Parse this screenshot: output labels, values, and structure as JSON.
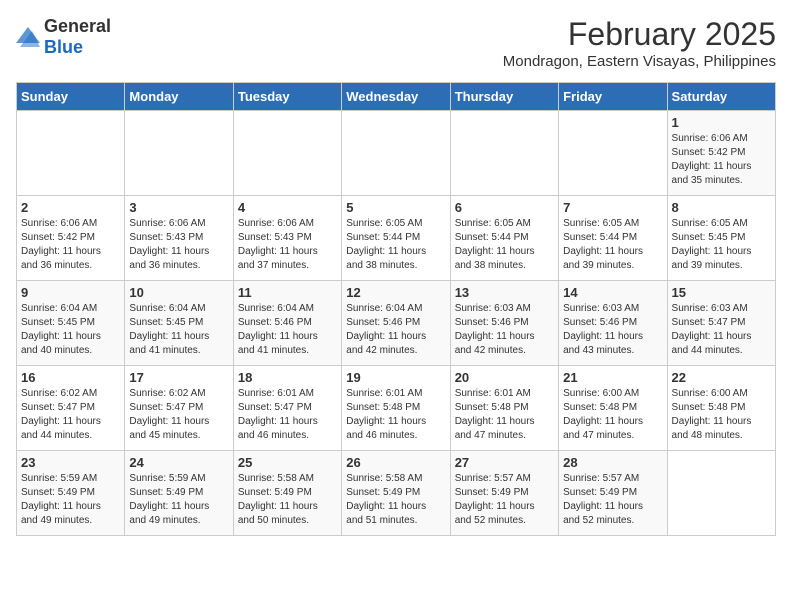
{
  "header": {
    "logo_general": "General",
    "logo_blue": "Blue",
    "main_title": "February 2025",
    "subtitle": "Mondragon, Eastern Visayas, Philippines"
  },
  "calendar": {
    "days_of_week": [
      "Sunday",
      "Monday",
      "Tuesday",
      "Wednesday",
      "Thursday",
      "Friday",
      "Saturday"
    ],
    "weeks": [
      {
        "days": [
          {
            "number": "",
            "info": ""
          },
          {
            "number": "",
            "info": ""
          },
          {
            "number": "",
            "info": ""
          },
          {
            "number": "",
            "info": ""
          },
          {
            "number": "",
            "info": ""
          },
          {
            "number": "",
            "info": ""
          },
          {
            "number": "1",
            "info": "Sunrise: 6:06 AM\nSunset: 5:42 PM\nDaylight: 11 hours\nand 35 minutes."
          }
        ]
      },
      {
        "days": [
          {
            "number": "2",
            "info": "Sunrise: 6:06 AM\nSunset: 5:42 PM\nDaylight: 11 hours\nand 36 minutes."
          },
          {
            "number": "3",
            "info": "Sunrise: 6:06 AM\nSunset: 5:43 PM\nDaylight: 11 hours\nand 36 minutes."
          },
          {
            "number": "4",
            "info": "Sunrise: 6:06 AM\nSunset: 5:43 PM\nDaylight: 11 hours\nand 37 minutes."
          },
          {
            "number": "5",
            "info": "Sunrise: 6:05 AM\nSunset: 5:44 PM\nDaylight: 11 hours\nand 38 minutes."
          },
          {
            "number": "6",
            "info": "Sunrise: 6:05 AM\nSunset: 5:44 PM\nDaylight: 11 hours\nand 38 minutes."
          },
          {
            "number": "7",
            "info": "Sunrise: 6:05 AM\nSunset: 5:44 PM\nDaylight: 11 hours\nand 39 minutes."
          },
          {
            "number": "8",
            "info": "Sunrise: 6:05 AM\nSunset: 5:45 PM\nDaylight: 11 hours\nand 39 minutes."
          }
        ]
      },
      {
        "days": [
          {
            "number": "9",
            "info": "Sunrise: 6:04 AM\nSunset: 5:45 PM\nDaylight: 11 hours\nand 40 minutes."
          },
          {
            "number": "10",
            "info": "Sunrise: 6:04 AM\nSunset: 5:45 PM\nDaylight: 11 hours\nand 41 minutes."
          },
          {
            "number": "11",
            "info": "Sunrise: 6:04 AM\nSunset: 5:46 PM\nDaylight: 11 hours\nand 41 minutes."
          },
          {
            "number": "12",
            "info": "Sunrise: 6:04 AM\nSunset: 5:46 PM\nDaylight: 11 hours\nand 42 minutes."
          },
          {
            "number": "13",
            "info": "Sunrise: 6:03 AM\nSunset: 5:46 PM\nDaylight: 11 hours\nand 42 minutes."
          },
          {
            "number": "14",
            "info": "Sunrise: 6:03 AM\nSunset: 5:46 PM\nDaylight: 11 hours\nand 43 minutes."
          },
          {
            "number": "15",
            "info": "Sunrise: 6:03 AM\nSunset: 5:47 PM\nDaylight: 11 hours\nand 44 minutes."
          }
        ]
      },
      {
        "days": [
          {
            "number": "16",
            "info": "Sunrise: 6:02 AM\nSunset: 5:47 PM\nDaylight: 11 hours\nand 44 minutes."
          },
          {
            "number": "17",
            "info": "Sunrise: 6:02 AM\nSunset: 5:47 PM\nDaylight: 11 hours\nand 45 minutes."
          },
          {
            "number": "18",
            "info": "Sunrise: 6:01 AM\nSunset: 5:47 PM\nDaylight: 11 hours\nand 46 minutes."
          },
          {
            "number": "19",
            "info": "Sunrise: 6:01 AM\nSunset: 5:48 PM\nDaylight: 11 hours\nand 46 minutes."
          },
          {
            "number": "20",
            "info": "Sunrise: 6:01 AM\nSunset: 5:48 PM\nDaylight: 11 hours\nand 47 minutes."
          },
          {
            "number": "21",
            "info": "Sunrise: 6:00 AM\nSunset: 5:48 PM\nDaylight: 11 hours\nand 47 minutes."
          },
          {
            "number": "22",
            "info": "Sunrise: 6:00 AM\nSunset: 5:48 PM\nDaylight: 11 hours\nand 48 minutes."
          }
        ]
      },
      {
        "days": [
          {
            "number": "23",
            "info": "Sunrise: 5:59 AM\nSunset: 5:49 PM\nDaylight: 11 hours\nand 49 minutes."
          },
          {
            "number": "24",
            "info": "Sunrise: 5:59 AM\nSunset: 5:49 PM\nDaylight: 11 hours\nand 49 minutes."
          },
          {
            "number": "25",
            "info": "Sunrise: 5:58 AM\nSunset: 5:49 PM\nDaylight: 11 hours\nand 50 minutes."
          },
          {
            "number": "26",
            "info": "Sunrise: 5:58 AM\nSunset: 5:49 PM\nDaylight: 11 hours\nand 51 minutes."
          },
          {
            "number": "27",
            "info": "Sunrise: 5:57 AM\nSunset: 5:49 PM\nDaylight: 11 hours\nand 52 minutes."
          },
          {
            "number": "28",
            "info": "Sunrise: 5:57 AM\nSunset: 5:49 PM\nDaylight: 11 hours\nand 52 minutes."
          },
          {
            "number": "",
            "info": ""
          }
        ]
      }
    ]
  }
}
